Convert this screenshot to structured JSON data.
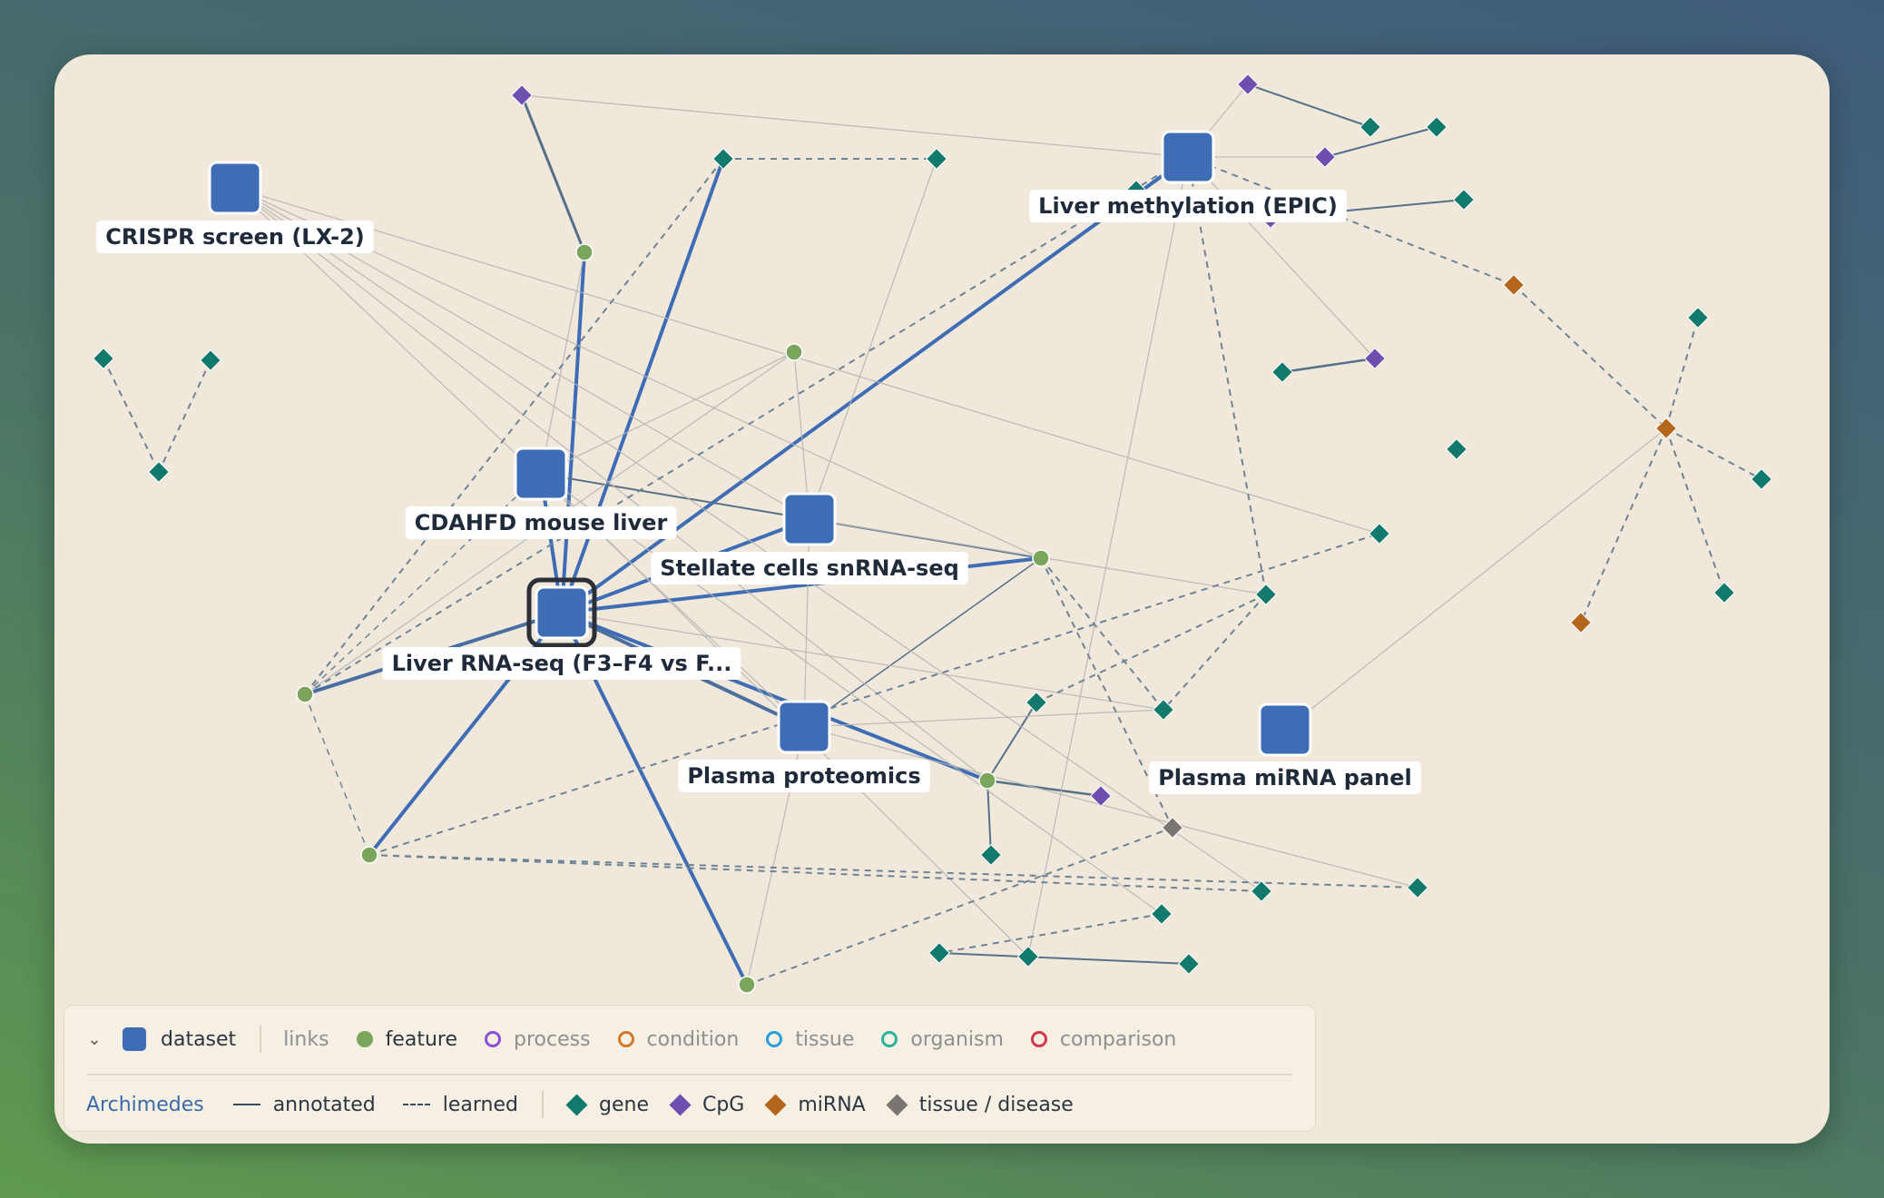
{
  "datasets": {
    "crispr": "CRISPR screen (LX-2)",
    "methylation": "Liver methylation (EPIC)",
    "cdahfd": "CDAHFD mouse liver",
    "stellate": "Stellate cells snRNA-seq",
    "rnaseq": "Liver RNA-seq (F3–F4 vs F...",
    "proteomics": "Plasma proteomics",
    "mirna": "Plasma miRNA panel"
  },
  "legend": {
    "collapse_icon": "chevron-down-icon",
    "dataset": "dataset",
    "links": "links",
    "feature": "feature",
    "process": "process",
    "condition": "condition",
    "tissue": "tissue",
    "organism": "organism",
    "comparison": "comparison",
    "source": "Archimedes",
    "annotated": "annotated",
    "learned": "learned",
    "gene": "gene",
    "cpg": "CpG",
    "mirna": "miRNA",
    "tissue_disease": "tissue / disease"
  },
  "colors": {
    "dataset": "#3e6db5",
    "feature": "#7aa55b",
    "process": "#8a4fd6",
    "condition": "#d07a2a",
    "tissue": "#2aa0d8",
    "organism": "#2bb39a",
    "comparison": "#d23a4a",
    "gene": "#127a6c",
    "cpg": "#6e4fb0",
    "mirna": "#b5661d",
    "tissue_disease": "#7a7570",
    "edge_strong": "#3e6db5",
    "edge_weak": "#b5b5b5",
    "edge_learned": "#6f8396"
  }
}
